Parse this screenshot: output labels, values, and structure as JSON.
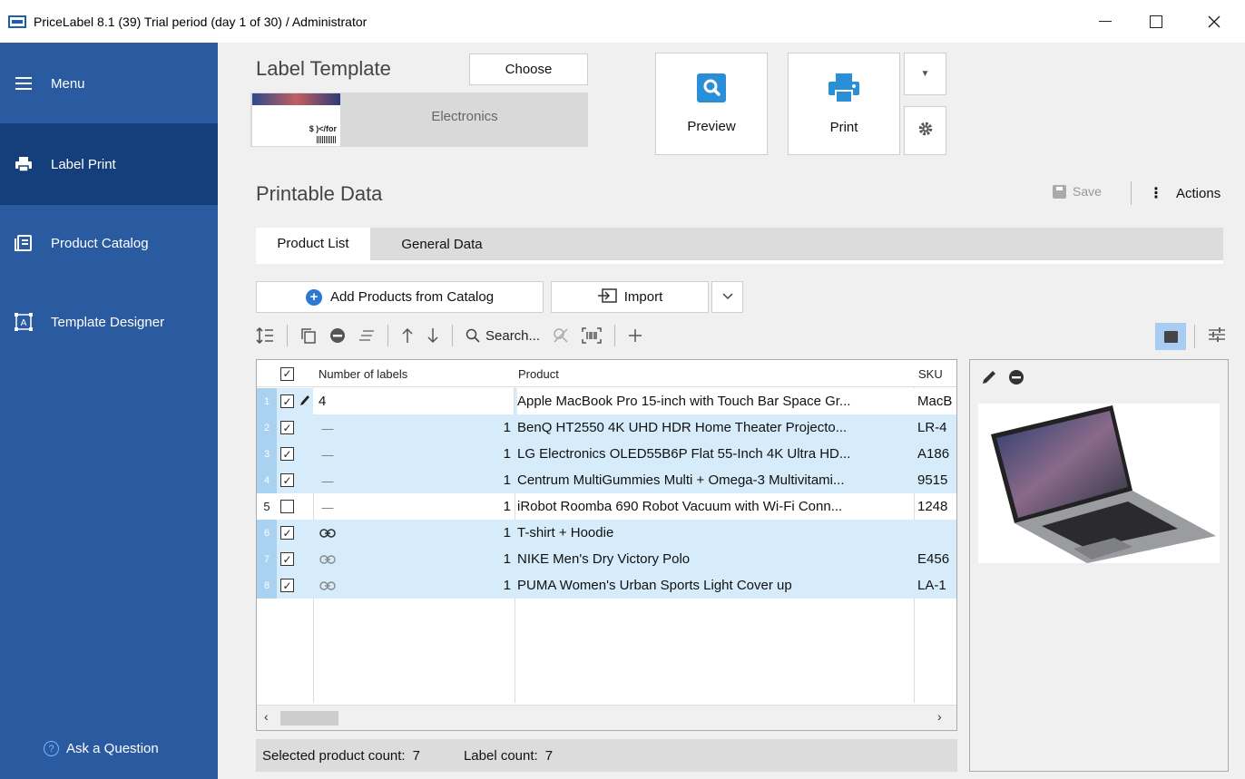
{
  "window": {
    "title": "PriceLabel 8.1 (39) Trial period (day 1 of 30) / Administrator"
  },
  "sidebar": {
    "menu_label": "Menu",
    "items": [
      {
        "label": "Label Print",
        "icon": "printer-icon",
        "active": true
      },
      {
        "label": "Product Catalog",
        "icon": "catalog-icon",
        "active": false
      },
      {
        "label": "Template Designer",
        "icon": "template-designer-icon",
        "active": false
      }
    ],
    "ask_label": "Ask a Question"
  },
  "template": {
    "heading": "Label Template",
    "choose_label": "Choose",
    "name": "Electronics",
    "thumb_price": "$ )</for"
  },
  "actions_bar": {
    "preview_label": "Preview",
    "print_label": "Print"
  },
  "printable": {
    "heading": "Printable Data",
    "save_label": "Save",
    "actions_label": "Actions",
    "tabs": [
      {
        "label": "Product List",
        "active": true
      },
      {
        "label": "General Data",
        "active": false
      }
    ],
    "add_label": "Add Products from Catalog",
    "import_label": "Import",
    "search_label": "Search..."
  },
  "grid": {
    "columns": [
      "Number of labels",
      "Product",
      "SKU"
    ],
    "rows": [
      {
        "idx": "1",
        "checked": true,
        "type": "edit",
        "num": "4",
        "product": "Apple MacBook Pro 15-inch with Touch Bar Space Gr...",
        "sku": "MacB"
      },
      {
        "idx": "2",
        "checked": true,
        "type": "single",
        "num": "1",
        "product": "BenQ HT2550 4K UHD HDR Home Theater Projecto...",
        "sku": "LR-4"
      },
      {
        "idx": "3",
        "checked": true,
        "type": "single",
        "num": "1",
        "product": "LG Electronics OLED55B6P Flat 55-Inch 4K Ultra HD...",
        "sku": "A186"
      },
      {
        "idx": "4",
        "checked": true,
        "type": "single",
        "num": "1",
        "product": "Centrum MultiGummies Multi + Omega-3 Multivitami...",
        "sku": "9515"
      },
      {
        "idx": "5",
        "checked": false,
        "type": "single",
        "num": "1",
        "product": "iRobot Roomba 690 Robot Vacuum with Wi-Fi Conn...",
        "sku": "1248"
      },
      {
        "idx": "6",
        "checked": true,
        "type": "link",
        "num": "1",
        "product": "T-shirt + Hoodie",
        "sku": ""
      },
      {
        "idx": "7",
        "checked": true,
        "type": "link",
        "num": "1",
        "product": "NIKE Men's Dry Victory Polo",
        "sku": "E456"
      },
      {
        "idx": "8",
        "checked": true,
        "type": "link",
        "num": "1",
        "product": "PUMA Women's Urban Sports Light Cover up",
        "sku": "LA-1"
      }
    ]
  },
  "status": {
    "selected_label": "Selected product count:",
    "selected_value": "7",
    "label_count_label": "Label count:",
    "label_count_value": "7"
  },
  "colors": {
    "sidebar": "#2a5aa0",
    "sidebar_active": "#153f7a",
    "accent": "#2b79d4",
    "row_selected": "#d6ecfb"
  }
}
